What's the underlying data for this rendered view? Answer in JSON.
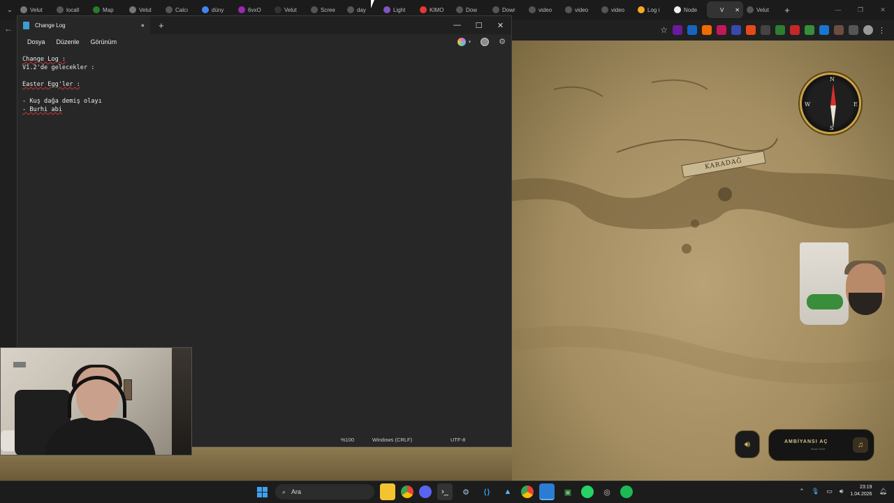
{
  "browser": {
    "tabs": [
      {
        "label": "Velut",
        "color": "#777"
      },
      {
        "label": "locall",
        "color": "#555"
      },
      {
        "label": "Map",
        "color": "#2c7a2c"
      },
      {
        "label": "Velut",
        "color": "#777"
      },
      {
        "label": "Calcı",
        "color": "#555"
      },
      {
        "label": "düny",
        "color": "#4285f4"
      },
      {
        "label": "6vxO",
        "color": "#9c27b0"
      },
      {
        "label": "Velut",
        "color": "#333"
      },
      {
        "label": "Scree",
        "color": "#555"
      },
      {
        "label": "day",
        "color": "#555"
      },
      {
        "label": "Light",
        "color": "#7e57c2"
      },
      {
        "label": "KIMO",
        "color": "#e53935"
      },
      {
        "label": "Dow",
        "color": "#555"
      },
      {
        "label": "Dowr",
        "color": "#555"
      },
      {
        "label": "video",
        "color": "#555"
      },
      {
        "label": "video",
        "color": "#555"
      },
      {
        "label": "video",
        "color": "#555"
      },
      {
        "label": "Log i",
        "color": "#f9a825"
      },
      {
        "label": "Node",
        "color": "#eee"
      },
      {
        "label": "V",
        "color": "#333"
      },
      {
        "label": "Velut",
        "color": "#555"
      }
    ],
    "active_tab_index": 19,
    "new_tab": "+"
  },
  "notepad": {
    "title": "Change Log",
    "unsaved_dot": "●",
    "new_tab": "+",
    "menus": [
      "Dosya",
      "Düzenle",
      "Görünüm"
    ],
    "lines": [
      "Change Log :",
      "V1.2'de gelecekler :",
      "",
      "Easter Egg'ler :",
      "",
      "- Kuş dağa demiş olayı",
      "- Burhi abi"
    ],
    "status": {
      "zoom": "%100",
      "line_ending": "Windows (CRLF)",
      "encoding": "UTF-8"
    }
  },
  "map": {
    "region_label": "KARADAĞ",
    "compass": {
      "n": "N",
      "s": "S",
      "e": "E",
      "w": "W"
    }
  },
  "ambiance": {
    "label": "AMBİYANSI AÇ",
    "sublabel": "Müzik Dinle"
  },
  "taskbar": {
    "search_placeholder": "Ara",
    "time": "23:19",
    "date": "1.04.2026"
  }
}
